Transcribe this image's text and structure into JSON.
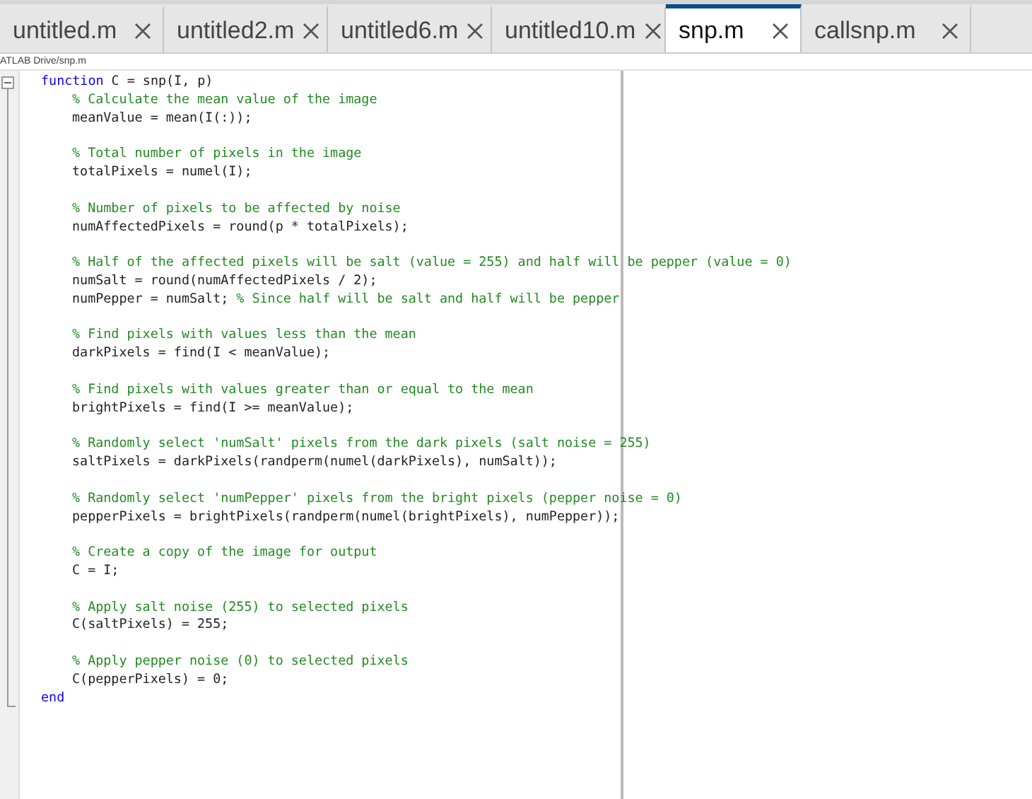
{
  "tabs": [
    {
      "label": "untitled.m",
      "selected": false
    },
    {
      "label": "untitled2.m",
      "selected": false
    },
    {
      "label": "untitled6.m",
      "selected": false
    },
    {
      "label": "untitled10.m",
      "selected": false
    },
    {
      "label": "snp.m",
      "selected": true
    },
    {
      "label": "callsnp.m",
      "selected": false
    }
  ],
  "path": "ATLAB Drive/snp.m",
  "lines": [
    {
      "kind": "top",
      "segments": [
        {
          "kind": "keyword",
          "text": "function"
        },
        {
          "kind": "code",
          "text": " C = snp(I, p)"
        }
      ]
    },
    {
      "kind": "body",
      "segments": [
        {
          "kind": "comment",
          "text": "% Calculate the mean value of the image"
        }
      ]
    },
    {
      "kind": "body",
      "segments": [
        {
          "kind": "code",
          "text": "meanValue = mean(I(:));"
        }
      ]
    },
    {
      "kind": "blank"
    },
    {
      "kind": "body",
      "segments": [
        {
          "kind": "comment",
          "text": "% Total number of pixels in the image"
        }
      ]
    },
    {
      "kind": "body",
      "segments": [
        {
          "kind": "code",
          "text": "totalPixels = numel(I);"
        }
      ]
    },
    {
      "kind": "blank"
    },
    {
      "kind": "body",
      "segments": [
        {
          "kind": "comment",
          "text": "% Number of pixels to be affected by noise"
        }
      ]
    },
    {
      "kind": "body",
      "segments": [
        {
          "kind": "code",
          "text": "numAffectedPixels = round(p * totalPixels);"
        }
      ]
    },
    {
      "kind": "blank"
    },
    {
      "kind": "body",
      "segments": [
        {
          "kind": "comment",
          "text": "% Half of the affected pixels will be salt (value = 255) and half will be pepper (value = 0)"
        }
      ]
    },
    {
      "kind": "body",
      "segments": [
        {
          "kind": "code",
          "text": "numSalt = round(numAffectedPixels / 2);"
        }
      ]
    },
    {
      "kind": "body",
      "segments": [
        {
          "kind": "code",
          "text": "numPepper = numSalt; "
        },
        {
          "kind": "comment",
          "text": "% Since half will be salt and half will be pepper"
        }
      ]
    },
    {
      "kind": "blank"
    },
    {
      "kind": "body",
      "segments": [
        {
          "kind": "comment",
          "text": "% Find pixels with values less than the mean"
        }
      ]
    },
    {
      "kind": "body",
      "segments": [
        {
          "kind": "code",
          "text": "darkPixels = find(I < meanValue);"
        }
      ]
    },
    {
      "kind": "blank"
    },
    {
      "kind": "body",
      "segments": [
        {
          "kind": "comment",
          "text": "% Find pixels with values greater than or equal to the mean"
        }
      ]
    },
    {
      "kind": "body",
      "segments": [
        {
          "kind": "code",
          "text": "brightPixels = find(I >= meanValue);"
        }
      ]
    },
    {
      "kind": "blank"
    },
    {
      "kind": "body",
      "segments": [
        {
          "kind": "comment",
          "text": "% Randomly select 'numSalt' pixels from the dark pixels (salt noise = 255)"
        }
      ]
    },
    {
      "kind": "body",
      "segments": [
        {
          "kind": "code",
          "text": "saltPixels = darkPixels(randperm(numel(darkPixels), numSalt));"
        }
      ]
    },
    {
      "kind": "blank"
    },
    {
      "kind": "body",
      "segments": [
        {
          "kind": "comment",
          "text": "% Randomly select 'numPepper' pixels from the bright pixels (pepper noise = 0)"
        }
      ]
    },
    {
      "kind": "body",
      "segments": [
        {
          "kind": "code",
          "text": "pepperPixels = brightPixels(randperm(numel(brightPixels), numPepper));"
        }
      ]
    },
    {
      "kind": "blank"
    },
    {
      "kind": "body",
      "segments": [
        {
          "kind": "comment",
          "text": "% Create a copy of the image for output"
        }
      ]
    },
    {
      "kind": "body",
      "segments": [
        {
          "kind": "code",
          "text": "C = I;"
        }
      ]
    },
    {
      "kind": "blank"
    },
    {
      "kind": "body",
      "segments": [
        {
          "kind": "comment",
          "text": "% Apply salt noise (255) to selected pixels"
        }
      ]
    },
    {
      "kind": "body",
      "segments": [
        {
          "kind": "code",
          "text": "C(saltPixels) = 255;"
        }
      ]
    },
    {
      "kind": "blank"
    },
    {
      "kind": "body",
      "segments": [
        {
          "kind": "comment",
          "text": "% Apply pepper noise (0) to selected pixels"
        }
      ]
    },
    {
      "kind": "body",
      "segments": [
        {
          "kind": "code",
          "text": "C(pepperPixels) = 0;"
        }
      ]
    },
    {
      "kind": "top",
      "segments": [
        {
          "kind": "keyword",
          "text": "end"
        }
      ]
    }
  ]
}
